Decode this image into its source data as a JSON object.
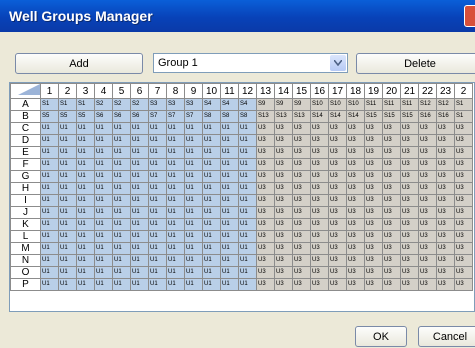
{
  "window": {
    "title": "Well Groups Manager"
  },
  "toolbar": {
    "add_label": "Add",
    "delete_label": "Delete"
  },
  "group_select": {
    "value": "Group 1"
  },
  "grid": {
    "columns": [
      "1",
      "2",
      "3",
      "4",
      "5",
      "6",
      "7",
      "8",
      "9",
      "10",
      "11",
      "12",
      "13",
      "14",
      "15",
      "16",
      "17",
      "18",
      "19",
      "20",
      "21",
      "22",
      "23",
      "2"
    ],
    "rows": [
      "A",
      "B",
      "C",
      "D",
      "E",
      "F",
      "G",
      "H",
      "I",
      "J",
      "K",
      "L",
      "M",
      "N",
      "O",
      "P"
    ],
    "cells": {
      "A": [
        "S1",
        "S1",
        "S1",
        "S2",
        "S2",
        "S2",
        "S3",
        "S3",
        "S3",
        "S4",
        "S4",
        "S4",
        "S9",
        "S9",
        "S9",
        "S10",
        "S10",
        "S10",
        "S11",
        "S11",
        "S11",
        "S12",
        "S12",
        "S1"
      ],
      "B": [
        "S5",
        "S5",
        "S5",
        "S6",
        "S6",
        "S6",
        "S7",
        "S7",
        "S7",
        "S8",
        "S8",
        "S8",
        "S13",
        "S13",
        "S13",
        "S14",
        "S14",
        "S14",
        "S15",
        "S15",
        "S15",
        "S16",
        "S16",
        "S1"
      ],
      "C": [
        "U1",
        "U1",
        "U1",
        "U1",
        "U1",
        "U1",
        "U1",
        "U1",
        "U1",
        "U1",
        "U1",
        "U1",
        "U3",
        "U3",
        "U3",
        "U3",
        "U3",
        "U3",
        "U3",
        "U3",
        "U3",
        "U3",
        "U3",
        "U3"
      ],
      "D": [
        "U1",
        "U1",
        "U1",
        "U1",
        "U1",
        "U1",
        "U1",
        "U1",
        "U1",
        "U1",
        "U1",
        "U1",
        "U3",
        "U3",
        "U3",
        "U3",
        "U3",
        "U3",
        "U3",
        "U3",
        "U3",
        "U3",
        "U3",
        "U3"
      ],
      "E": [
        "U1",
        "U1",
        "U1",
        "U1",
        "U1",
        "U1",
        "U1",
        "U1",
        "U1",
        "U1",
        "U1",
        "U1",
        "U3",
        "U3",
        "U3",
        "U3",
        "U3",
        "U3",
        "U3",
        "U3",
        "U3",
        "U3",
        "U3",
        "U3"
      ],
      "F": [
        "U1",
        "U1",
        "U1",
        "U1",
        "U1",
        "U1",
        "U1",
        "U1",
        "U1",
        "U1",
        "U1",
        "U1",
        "U3",
        "U3",
        "U3",
        "U3",
        "U3",
        "U3",
        "U3",
        "U3",
        "U3",
        "U3",
        "U3",
        "U3"
      ],
      "G": [
        "U1",
        "U1",
        "U1",
        "U1",
        "U1",
        "U1",
        "U1",
        "U1",
        "U1",
        "U1",
        "U1",
        "U1",
        "U3",
        "U3",
        "U3",
        "U3",
        "U3",
        "U3",
        "U3",
        "U3",
        "U3",
        "U3",
        "U3",
        "U3"
      ],
      "H": [
        "U1",
        "U1",
        "U1",
        "U1",
        "U1",
        "U1",
        "U1",
        "U1",
        "U1",
        "U1",
        "U1",
        "U1",
        "U3",
        "U3",
        "U3",
        "U3",
        "U3",
        "U3",
        "U3",
        "U3",
        "U3",
        "U3",
        "U3",
        "U3"
      ],
      "I": [
        "U1",
        "U1",
        "U1",
        "U1",
        "U1",
        "U1",
        "U1",
        "U1",
        "U1",
        "U1",
        "U1",
        "U1",
        "U3",
        "U3",
        "U3",
        "U3",
        "U3",
        "U3",
        "U3",
        "U3",
        "U3",
        "U3",
        "U3",
        "U3"
      ],
      "J": [
        "U1",
        "U1",
        "U1",
        "U1",
        "U1",
        "U1",
        "U1",
        "U1",
        "U1",
        "U1",
        "U1",
        "U1",
        "U3",
        "U3",
        "U3",
        "U3",
        "U3",
        "U3",
        "U3",
        "U3",
        "U3",
        "U3",
        "U3",
        "U3"
      ],
      "K": [
        "U1",
        "U1",
        "U1",
        "U1",
        "U1",
        "U1",
        "U1",
        "U1",
        "U1",
        "U1",
        "U1",
        "U1",
        "U3",
        "U3",
        "U3",
        "U3",
        "U3",
        "U3",
        "U3",
        "U3",
        "U3",
        "U3",
        "U3",
        "U3"
      ],
      "L": [
        "U1",
        "U1",
        "U1",
        "U1",
        "U1",
        "U1",
        "U1",
        "U1",
        "U1",
        "U1",
        "U1",
        "U1",
        "U3",
        "U3",
        "U3",
        "U3",
        "U3",
        "U3",
        "U3",
        "U3",
        "U3",
        "U3",
        "U3",
        "U3"
      ],
      "M": [
        "U1",
        "U1",
        "U1",
        "U1",
        "U1",
        "U1",
        "U1",
        "U1",
        "U1",
        "U1",
        "U1",
        "U1",
        "U3",
        "U3",
        "U3",
        "U3",
        "U3",
        "U3",
        "U3",
        "U3",
        "U3",
        "U3",
        "U3",
        "U3"
      ],
      "N": [
        "U1",
        "U1",
        "U1",
        "U1",
        "U1",
        "U1",
        "U1",
        "U1",
        "U1",
        "U1",
        "U1",
        "U1",
        "U3",
        "U3",
        "U3",
        "U3",
        "U3",
        "U3",
        "U3",
        "U3",
        "U3",
        "U3",
        "U3",
        "U3"
      ],
      "O": [
        "U1",
        "U1",
        "U1",
        "U1",
        "U1",
        "U1",
        "U1",
        "U1",
        "U1",
        "U1",
        "U1",
        "U1",
        "U3",
        "U3",
        "U3",
        "U3",
        "U3",
        "U3",
        "U3",
        "U3",
        "U3",
        "U3",
        "U3",
        "U3"
      ],
      "P": [
        "U1",
        "U1",
        "U1",
        "U1",
        "U1",
        "U1",
        "U1",
        "U1",
        "U1",
        "U1",
        "U1",
        "U1",
        "U3",
        "U3",
        "U3",
        "U3",
        "U3",
        "U3",
        "U3",
        "U3",
        "U3",
        "U3",
        "U3",
        "U3"
      ]
    },
    "colors": {
      "selected": "#b9cfe8",
      "unselected": "#d4d0c8"
    }
  },
  "footer": {
    "ok_label": "OK",
    "cancel_label": "Cancel"
  }
}
